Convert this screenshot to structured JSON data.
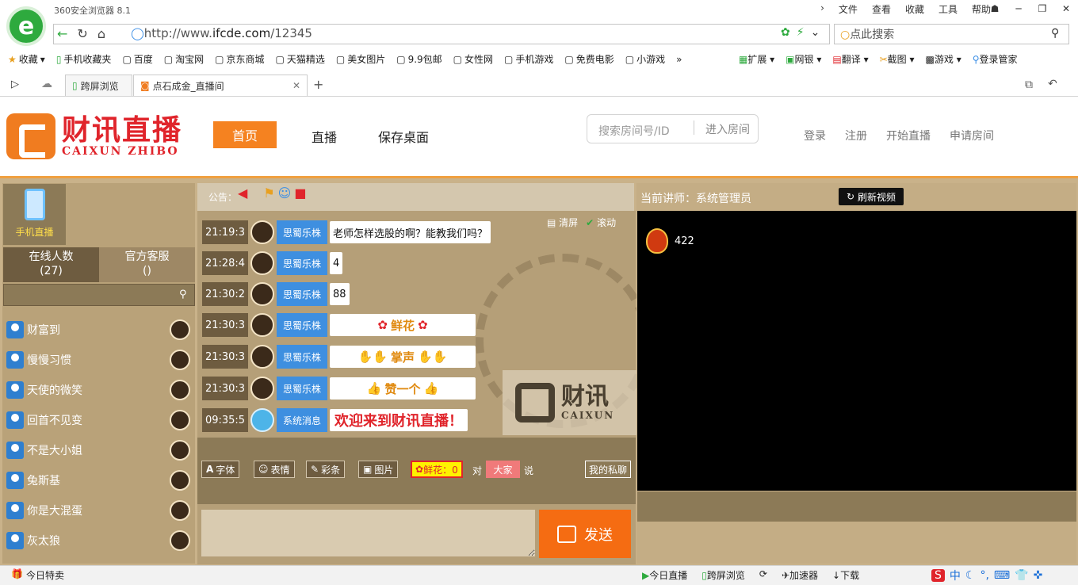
{
  "browser": {
    "app_name": "360安全浏览器 8.1",
    "menus": [
      "文件",
      "查看",
      "收藏",
      "工具",
      "帮助"
    ],
    "url_scheme": "http://www.",
    "url_host": "ifcde.com",
    "url_path": "/12345",
    "search_placeholder": "点此搜索",
    "bookmarks": [
      "收藏",
      "手机收藏夹",
      "百度",
      "淘宝网",
      "京东商城",
      "天猫精选",
      "美女图片",
      "9.9包邮",
      "女性网",
      "手机游戏",
      "免费电影",
      "小游戏"
    ],
    "extensions": [
      "扩展",
      "网银",
      "翻译",
      "截图",
      "游戏",
      "登录管家"
    ],
    "tabs": [
      "跨屏浏览",
      "点石成金_直播间"
    ]
  },
  "site": {
    "brand_cn": "财讯直播",
    "brand_en": "CAIXUN ZHIBO",
    "nav": [
      "首页",
      "直播",
      "保存桌面"
    ],
    "room_search_placeholder": "搜索房间号/ID",
    "room_enter": "进入房间",
    "top_links": [
      "登录",
      "注册",
      "开始直播",
      "申请房间"
    ]
  },
  "sidebar": {
    "mobile_label": "手机直播",
    "tab_online_title": "在线人数",
    "tab_online_count": "(27)",
    "tab_service_title": "官方客服",
    "tab_service_count": "()",
    "users": [
      "财富到",
      "慢慢习惯",
      "天使的微笑",
      "回首不见变",
      "不是大小姐",
      "兔斯基",
      "你是大混蛋",
      "灰太狼"
    ]
  },
  "chat": {
    "notice_label": "公告：",
    "clear_label": "清屏",
    "scroll_label": "滚动",
    "messages": [
      {
        "time": "21:19:3",
        "name": "思蜀乐株",
        "text": "老师怎样选股的啊？能教我们吗？"
      },
      {
        "time": "21:28:4",
        "name": "思蜀乐株",
        "text": "4"
      },
      {
        "time": "21:30:2",
        "name": "思蜀乐株",
        "text": "88"
      },
      {
        "time": "21:30:3",
        "name": "思蜀乐株",
        "text": "鲜花"
      },
      {
        "time": "21:30:3",
        "name": "思蜀乐株",
        "text": "掌声"
      },
      {
        "time": "21:30:3",
        "name": "思蜀乐株",
        "text": "赞一个"
      },
      {
        "time": "09:35:5",
        "name": "系统消息",
        "text": "欢迎来到财讯直播！"
      }
    ],
    "watermark_cn": "财讯",
    "watermark_en": "CAIXUN"
  },
  "toolbar": {
    "font": "字体",
    "emoji": "表情",
    "color": "彩条",
    "image": "图片",
    "flower": "鲜花：0",
    "to": "对",
    "target": "大家",
    "say": "说",
    "private_chat": "我的私聊",
    "send": "发送"
  },
  "video": {
    "lecturer": "当前讲师：系统管理员",
    "refresh": "刷新视频",
    "viewers": "422"
  },
  "statusbar": {
    "today": "今日特卖",
    "items": [
      "今日直播",
      "跨屏浏览",
      "加速器",
      "下载"
    ],
    "ime": "中"
  }
}
